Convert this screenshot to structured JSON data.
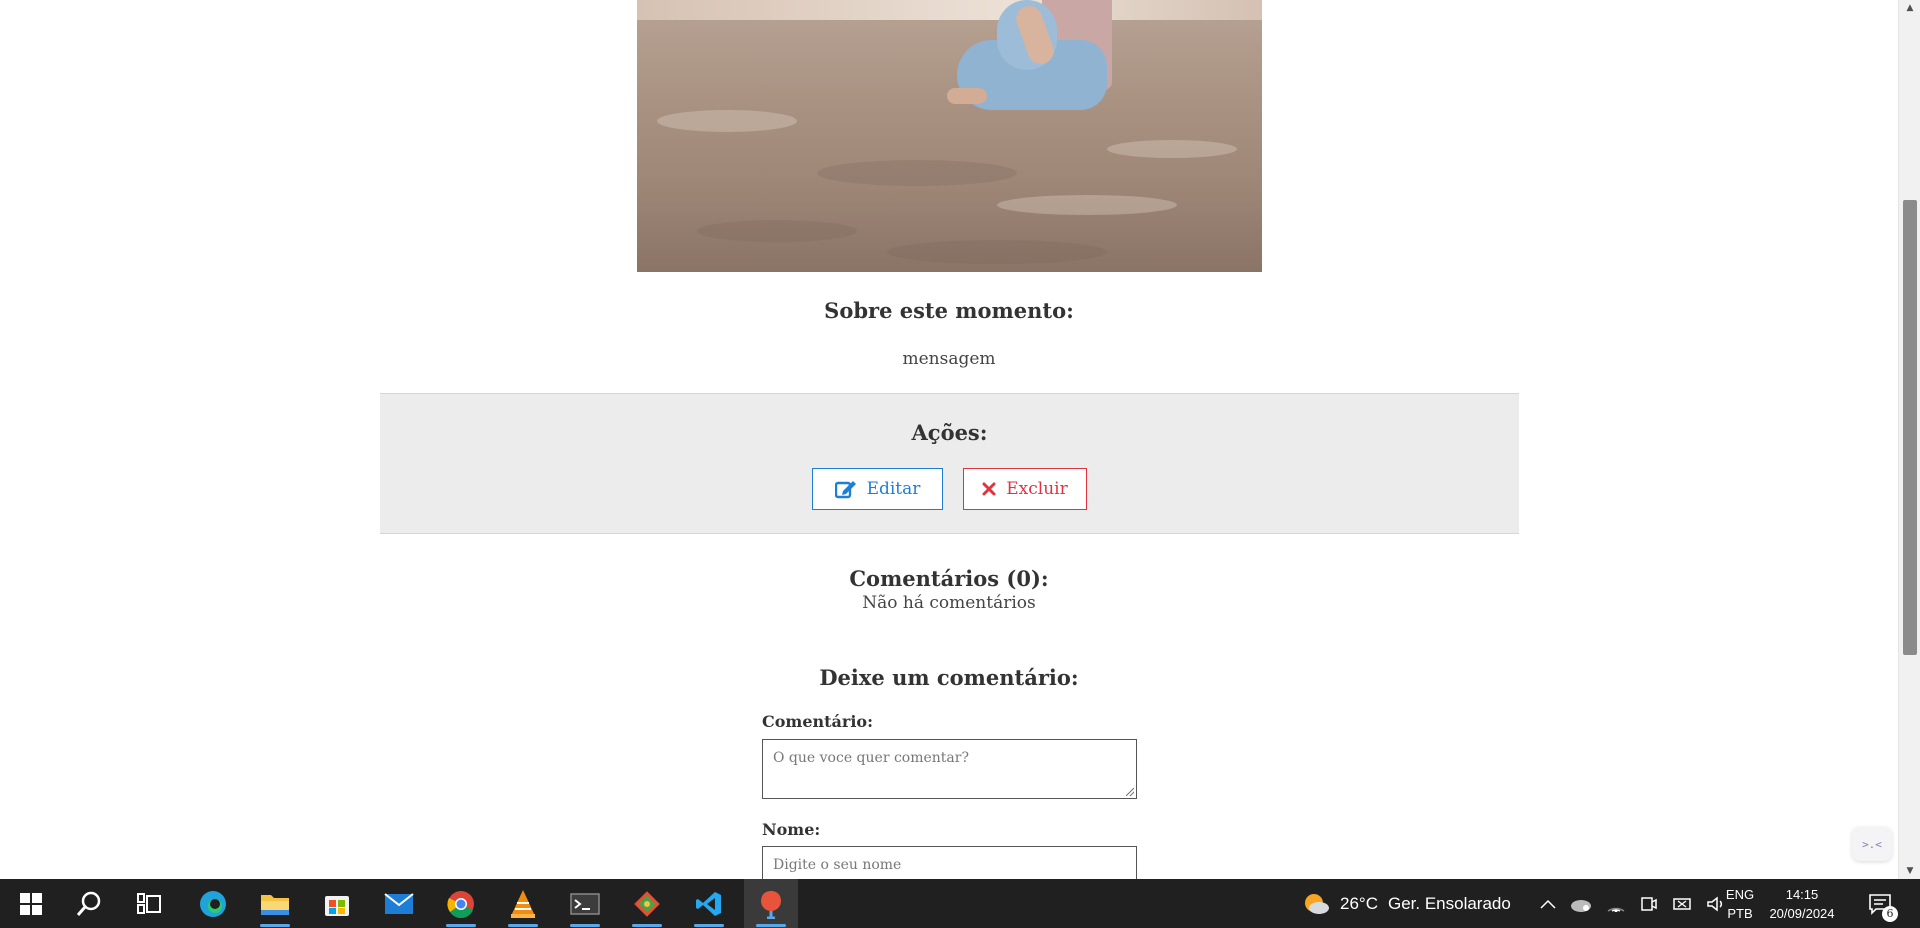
{
  "post": {
    "about_heading": "Sobre este momento:",
    "message": "mensagem"
  },
  "actions": {
    "heading": "Ações:",
    "edit_label": "Editar",
    "delete_label": "Excluir"
  },
  "comments": {
    "heading": "Comentários (0):",
    "empty_text": "Não há comentários"
  },
  "comment_form": {
    "heading": "Deixe um comentário:",
    "comment_label": "Comentário:",
    "comment_placeholder": "O que voce quer comentar?",
    "name_label": "Nome:",
    "name_placeholder": "Digite o seu nome"
  },
  "colors": {
    "edit_accent": "#1e7ed6",
    "delete_accent": "#e0323f",
    "actions_bg": "#ececec"
  },
  "taskbar": {
    "apps": [
      "start-icon",
      "search-icon",
      "task-view-icon",
      "edge-icon",
      "file-explorer-icon",
      "microsoft-store-icon",
      "mail-icon",
      "chrome-icon",
      "vlc-icon",
      "terminal-icon",
      "git-gui-icon",
      "vscode-icon",
      "postman-icon"
    ],
    "weather_temp": "26°C",
    "weather_desc": "Ger. Ensolarado",
    "lang_top": "ENG",
    "lang_bottom": "PTB",
    "time": "14:15",
    "date": "20/09/2024",
    "notification_count": "6"
  }
}
